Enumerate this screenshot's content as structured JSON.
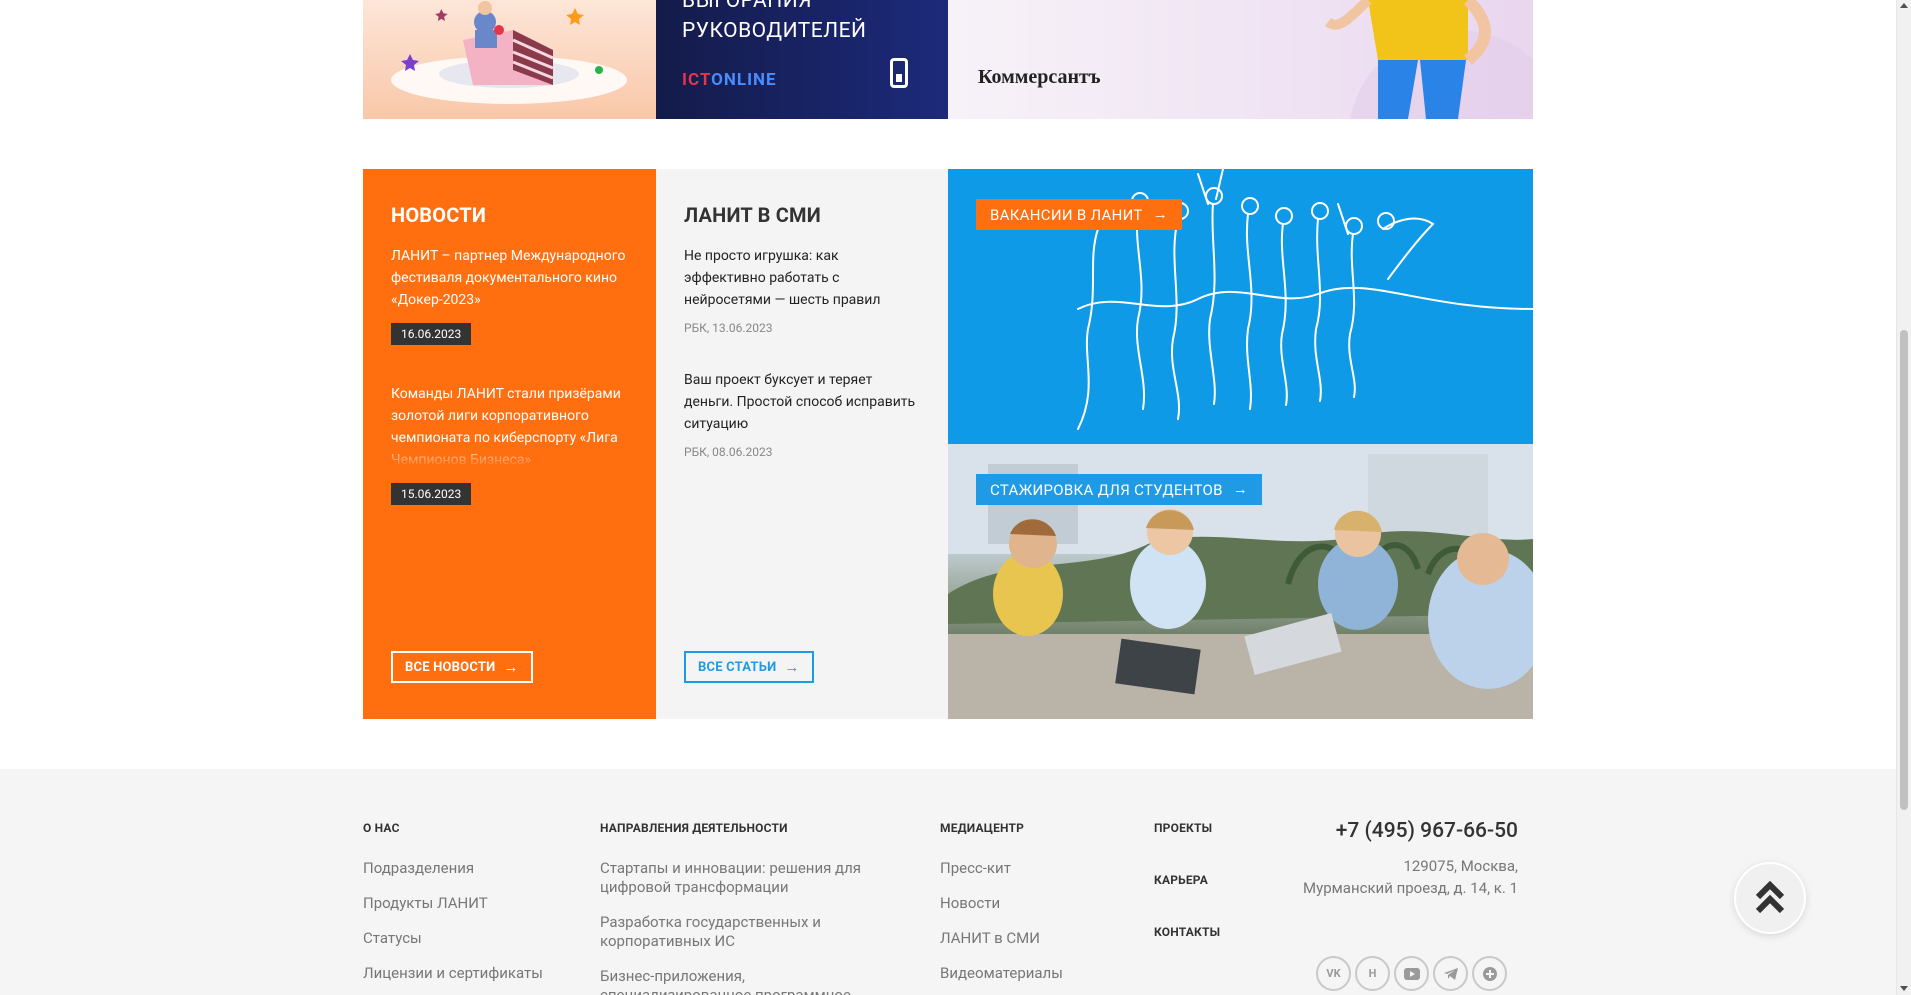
{
  "banners": {
    "ict_title": "РУКОВОДИТЕЛЕЙ",
    "ict_title_partial": "ВЫГОРАНИЯ",
    "ict_logo_red": "ICT",
    "ict_logo_blue": "ONLINE",
    "kommersant_logo": "Коммерсантъ"
  },
  "news": {
    "title": "НОВОСТИ",
    "items": [
      {
        "text": "ЛАНИТ – партнер Международного фестиваля документального кино «Докер-2023»",
        "date": "16.06.2023"
      },
      {
        "text": "Команды ЛАНИТ стали призёрами золотой лиги корпоративного чемпионата по киберспорту «Лига Чемпионов Бизнеса»",
        "date": "15.06.2023"
      }
    ],
    "all_label": "ВСЕ НОВОСТИ"
  },
  "media": {
    "title": "ЛАНИТ В СМИ",
    "items": [
      {
        "text": "Не просто игрушка: как эффективно работать с нейросетями — шесть правил",
        "source": "РБК, 13.06.2023"
      },
      {
        "text": "Ваш проект буксует и теряет деньги. Простой способ исправить ситуацию",
        "source": "РБК, 08.06.2023"
      }
    ],
    "all_label": "ВСЕ СТАТЬИ"
  },
  "vacancy_label": "ВАКАНСИИ В ЛАНИТ",
  "intern_label": "СТАЖИРОВКА ДЛЯ СТУДЕНТОВ",
  "footer": {
    "about": {
      "title": "О НАС",
      "links": [
        "Подразделения",
        "Продукты ЛАНИТ",
        "Статусы",
        "Лицензии и сертификаты"
      ]
    },
    "directions": {
      "title": "НАПРАВЛЕНИЯ ДЕЯТЕЛЬНОСТИ",
      "links": [
        "Стартапы и инновации: решения для цифровой трансформации",
        "Разработка государственных и корпоративных ИС",
        "Бизнес-приложения, специализированное программное"
      ]
    },
    "media": {
      "title": "МЕДИАЦЕНТР",
      "links": [
        "Пресс-кит",
        "Новости",
        "ЛАНИТ в СМИ",
        "Видеоматериалы"
      ]
    },
    "projects": "ПРОЕКТЫ",
    "career": "КАРЬЕРА",
    "contacts": "КОНТАКТЫ",
    "phone": "+7 (495) 967-66-50",
    "address_line1": "129075, Москва,",
    "address_line2": "Мурманский проезд, д. 14, к. 1",
    "socials": [
      "vk-icon",
      "habr-icon",
      "youtube-icon",
      "telegram-icon",
      "plus-icon"
    ]
  },
  "colors": {
    "orange": "#ff6f10",
    "blue": "#0f9ae8",
    "dark": "#333333"
  }
}
